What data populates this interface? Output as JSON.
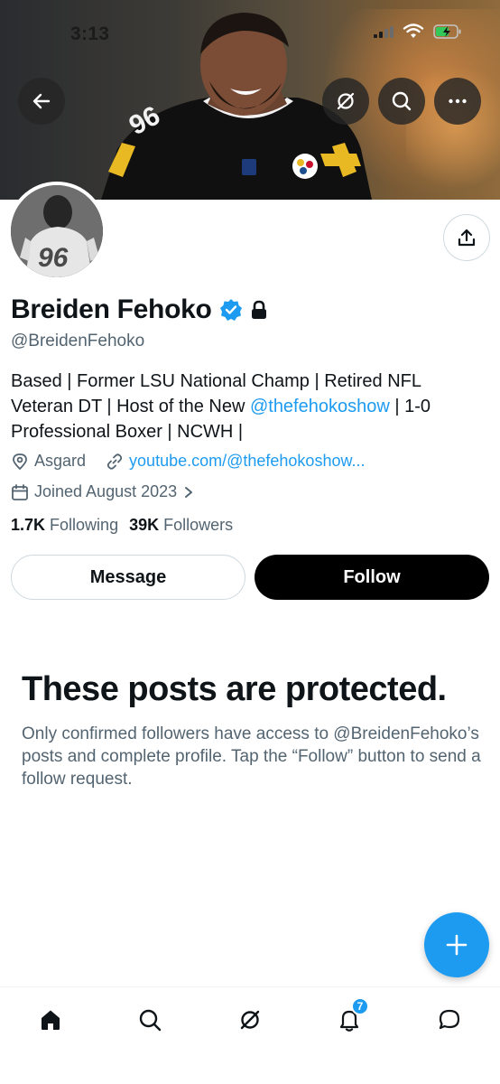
{
  "status_bar": {
    "time": "3:13"
  },
  "profile": {
    "name": "Breiden Fehoko",
    "handle": "@BreidenFehoko",
    "bio_text_1": "Based | Former LSU National Champ | Retired NFL Veteran DT | Host of the New ",
    "bio_mention": "@thefehokoshow",
    "bio_text_2": " | 1-0 Professional Boxer | NCWH |",
    "location": "Asgard",
    "website": "youtube.com/@thefehokoshow...",
    "joined": "Joined August 2023",
    "following_count": "1.7K",
    "following_label": "Following",
    "followers_count": "39K",
    "followers_label": "Followers",
    "avatar_jersey_number": "96"
  },
  "actions": {
    "message_label": "Message",
    "follow_label": "Follow"
  },
  "protected": {
    "title": "These posts are protected.",
    "body": "Only confirmed followers have access to @BreidenFehoko’s posts and complete profile. Tap the “Follow” button to send a follow request."
  },
  "bottom_nav": {
    "notifications_badge": "7"
  },
  "icons": {
    "back": "arrow-left-icon",
    "grok": "grok-icon",
    "search": "search-icon",
    "more": "more-icon",
    "share": "share-icon",
    "verified": "verified-badge-icon",
    "lock": "lock-icon",
    "location": "location-pin-icon",
    "link": "link-icon",
    "calendar": "calendar-icon",
    "compose": "plus-icon",
    "home": "home-icon",
    "notifications": "bell-icon",
    "messages": "message-icon"
  },
  "colors": {
    "accent": "#1d9bf0",
    "text": "#0f1419",
    "secondary_text": "#536471",
    "follow_button": "#000000"
  }
}
